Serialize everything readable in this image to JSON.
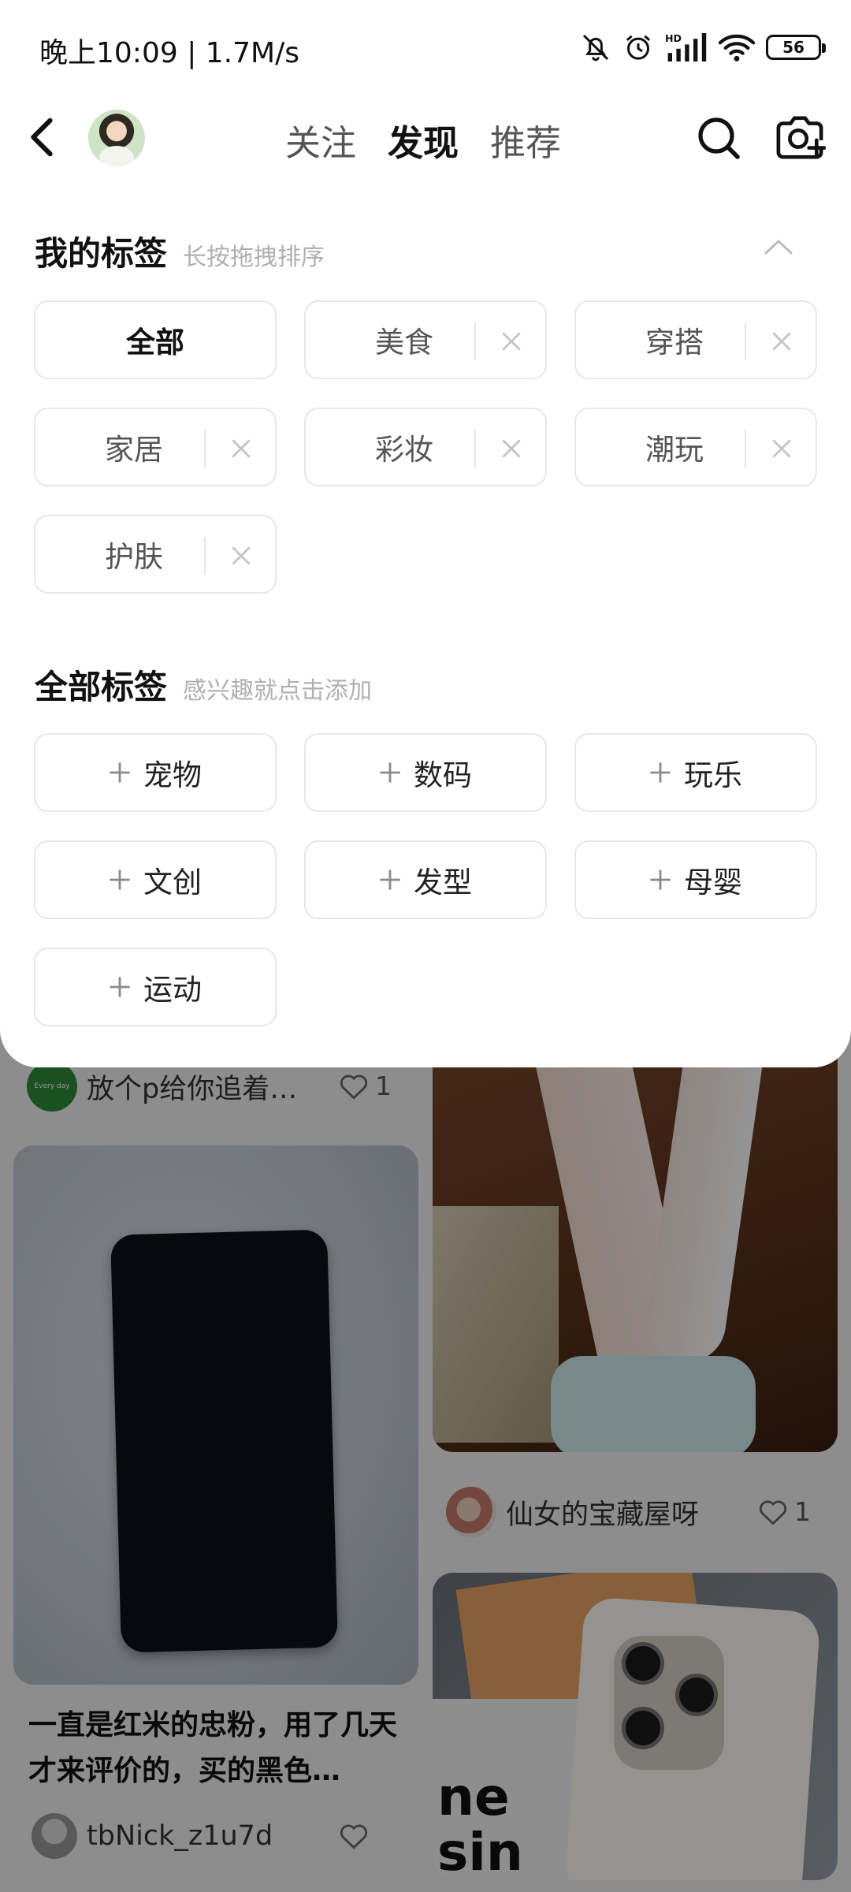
{
  "status_bar": {
    "time": "晚上10:09 | 1.7M/s",
    "battery": "56",
    "icons": [
      "mute-bell-icon",
      "alarm-icon",
      "signal-hd-icon",
      "wifi-icon",
      "battery-icon"
    ]
  },
  "nav": {
    "tabs": [
      {
        "label": "关注",
        "active": false
      },
      {
        "label": "发现",
        "active": true
      },
      {
        "label": "推荐",
        "active": false
      }
    ]
  },
  "my_tags": {
    "title": "我的标签",
    "hint": "长按拖拽排序",
    "items": [
      "全部",
      "美食",
      "穿搭",
      "家居",
      "彩妆",
      "潮玩",
      "护肤"
    ]
  },
  "all_tags": {
    "title": "全部标签",
    "hint": "感兴趣就点击添加",
    "items": [
      "宠物",
      "数码",
      "玩乐",
      "文创",
      "发型",
      "母婴",
      "运动"
    ]
  },
  "feed": {
    "post1": {
      "author": "放个p给你追着…",
      "likes": "1",
      "avatar_text": "Every day"
    },
    "post2": {
      "title": "一直是红米的忠粉，用了几天才来评价的，买的黑色…",
      "author": "tbNick_z1u7d",
      "likes": ""
    },
    "post3": {
      "author": "仙女的宝藏屋呀",
      "likes": "1"
    },
    "post4": {
      "overlay_text": "ne\nsin"
    }
  },
  "colors": {
    "accent_text": "#111111",
    "muted_text": "#b0b0b0",
    "chip_border": "#e8e8e8",
    "overlay": "rgba(0,0,0,0.42)"
  }
}
